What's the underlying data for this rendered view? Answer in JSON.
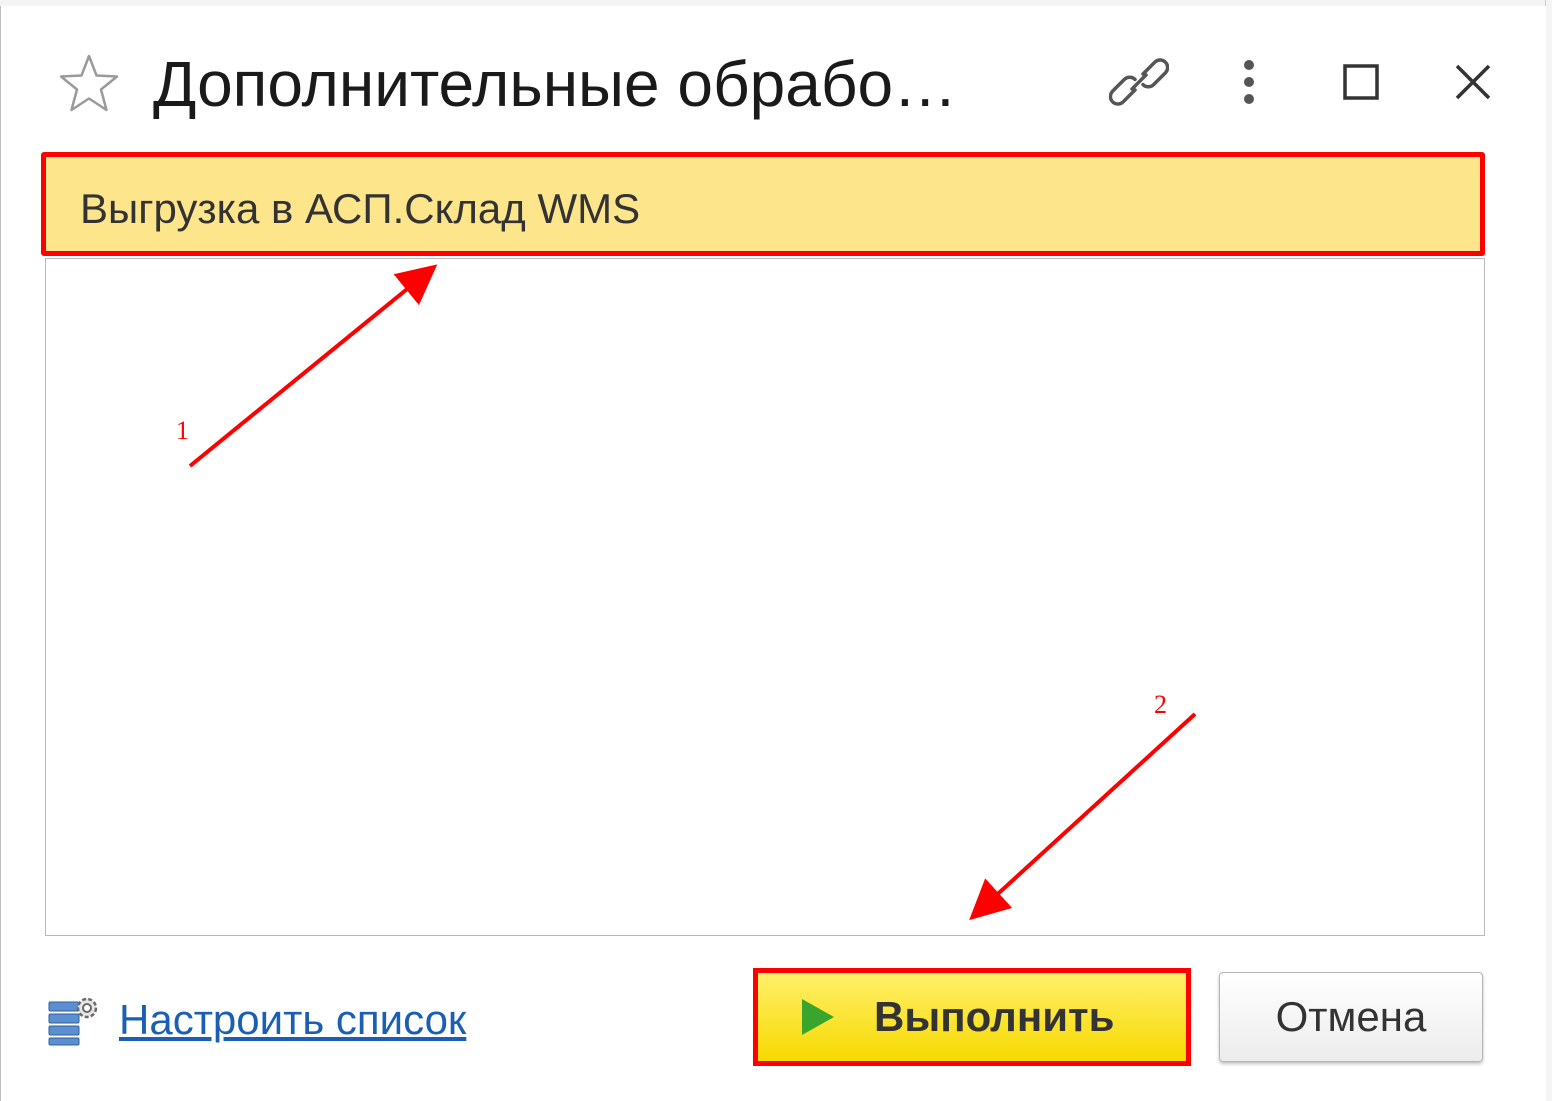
{
  "dialog": {
    "title": "Дополнительные обрабо…",
    "icons": {
      "favorite": "star-icon",
      "link": "link-icon",
      "more": "more-vertical-icon",
      "maximize": "maximize-icon",
      "close": "close-icon"
    }
  },
  "list": {
    "items": [
      {
        "label": "Выгрузка в АСП.Склад WMS",
        "selected": true
      }
    ]
  },
  "footer": {
    "settings_link": "Настроить список",
    "run_button": "Выполнить",
    "cancel_button": "Отмена"
  },
  "annotations": {
    "markers": [
      "1",
      "2"
    ],
    "color": "#ff0000"
  },
  "colors": {
    "selection": "#fde58c",
    "run_button": "#f7d900",
    "link": "#1b5fb5",
    "highlight": "#ff0000"
  }
}
